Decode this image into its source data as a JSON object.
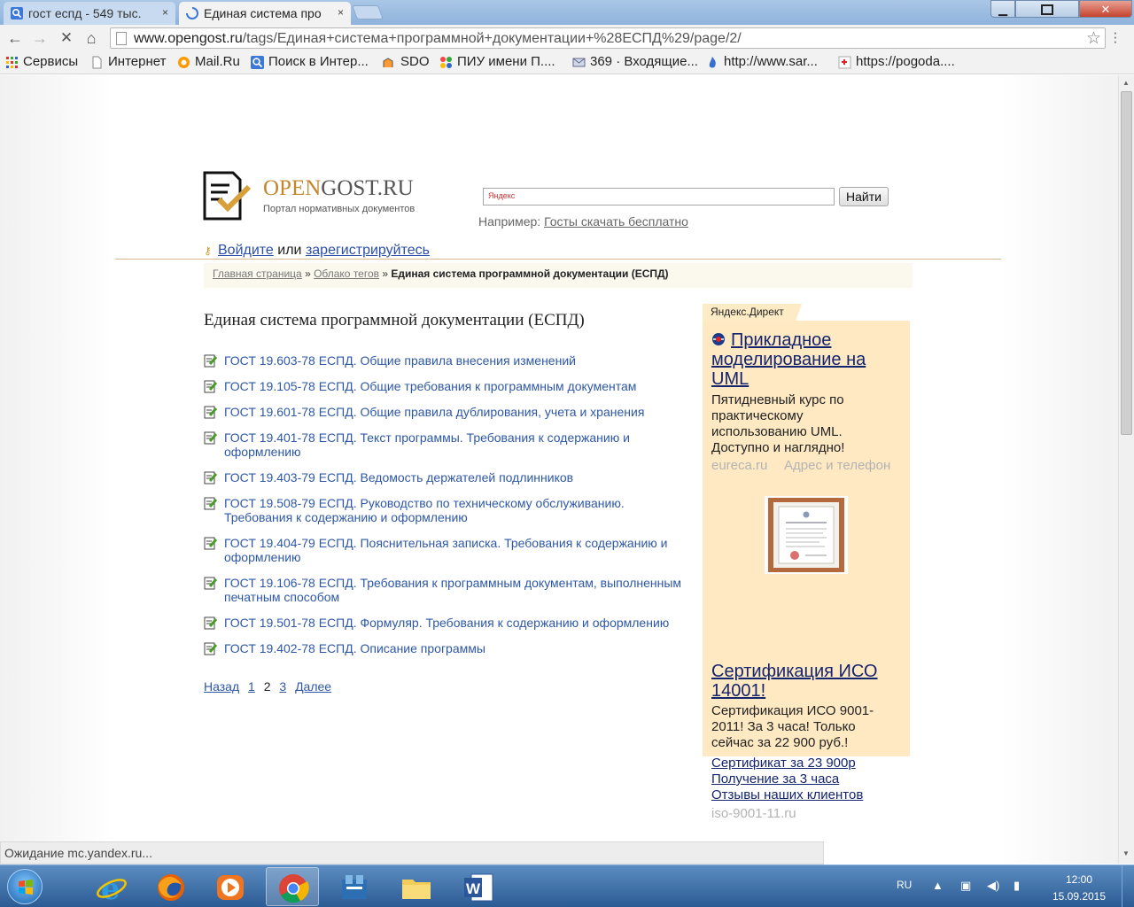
{
  "browser": {
    "tabs": [
      {
        "title": "гост еспд - 549 тыс.",
        "close": "×"
      },
      {
        "title": "Единая система про",
        "close": "×"
      }
    ],
    "window_title": "",
    "url_host": "www.opengost.ru",
    "url_path": "/tags/Единая+система+программной+документации+%28ЕСПД%29/page/2/",
    "bookmarks": [
      "Сервисы",
      "Интернет",
      "Mail.Ru",
      "Поиск в Интер...",
      "SDO",
      "ПИУ имени П....",
      "369 · Входящие...",
      "http://www.sar...",
      "https://pogoda...."
    ],
    "status": "Ожидание mc.yandex.ru..."
  },
  "site": {
    "logo_open": "OPEN",
    "logo_gost": "GOST.RU",
    "logo_sub": "Портал нормативных документов",
    "search_placeholder": "Яндекс",
    "search_button": "Найти",
    "example_label": "Например:",
    "example_link": "Госты скачать бесплатно",
    "login_link": "Войдите",
    "login_or": " или ",
    "register_link": "зарегистрируйтесь",
    "crumbs": {
      "home": "Главная страница",
      "sep": " » ",
      "tags": "Облако тегов",
      "current": "Единая система программной документации (ЕСПД)"
    },
    "page_title": "Единая система программной документации (ЕСПД)",
    "docs": [
      "ГОСТ 19.603-78 ЕСПД. Общие правила внесения изменений",
      "ГОСТ 19.105-78 ЕСПД. Общие требования к программным документам",
      "ГОСТ 19.601-78 ЕСПД. Общие правила дублирования, учета и хранения",
      "ГОСТ 19.401-78 ЕСПД. Текст программы. Требования к содержанию и оформлению",
      "ГОСТ 19.403-79 ЕСПД. Ведомость держателей подлинников",
      "ГОСТ 19.508-79 ЕСПД. Руководство по техническому обслуживанию. Требования к содержанию и оформлению",
      "ГОСТ 19.404-79 ЕСПД. Пояснительная записка. Требования к содержанию и оформлению",
      "ГОСТ 19.106-78 ЕСПД. Требования к программным документам, выполненным печатным способом",
      "ГОСТ 19.501-78 ЕСПД. Формуляр. Требования к содержанию и оформлению",
      "ГОСТ 19.402-78 ЕСПД. Описание программы"
    ],
    "pager": {
      "prev": "Назад",
      "p1": "1",
      "p2": "2",
      "p3": "3",
      "next": "Далее",
      "current_page": 2
    }
  },
  "ads": {
    "tag": "Яндекс.Директ",
    "ad1": {
      "title": "Прикладное моделирование на UML",
      "text": "Пятидневный курс по практическому использованию UML. Доступно и наглядно!",
      "domain": "eureca.ru",
      "contact": "Адрес и телефон"
    },
    "ad2": {
      "title": "Сертификация ИСО 14001!",
      "text": "Сертификация ИСО 9001-2011! За 3 часа! Только сейчас за 22 900 руб.!",
      "links": [
        "Сертификат за 23 900р",
        "Получение за 3 часа",
        "Отзывы наших клиентов"
      ],
      "domain": "iso-9001-11.ru"
    }
  },
  "taskbar": {
    "lang": "RU",
    "time": "12:00",
    "date": "15.09.2015",
    "apps": [
      "internet-explorer",
      "firefox",
      "media-player",
      "chrome",
      "app-launcher",
      "file-explorer",
      "word"
    ]
  },
  "colors": {
    "link": "#2e58a7",
    "logo_accent": "#c4862c",
    "ad_bg": "#fee9c3",
    "ad_title": "#14246e"
  }
}
